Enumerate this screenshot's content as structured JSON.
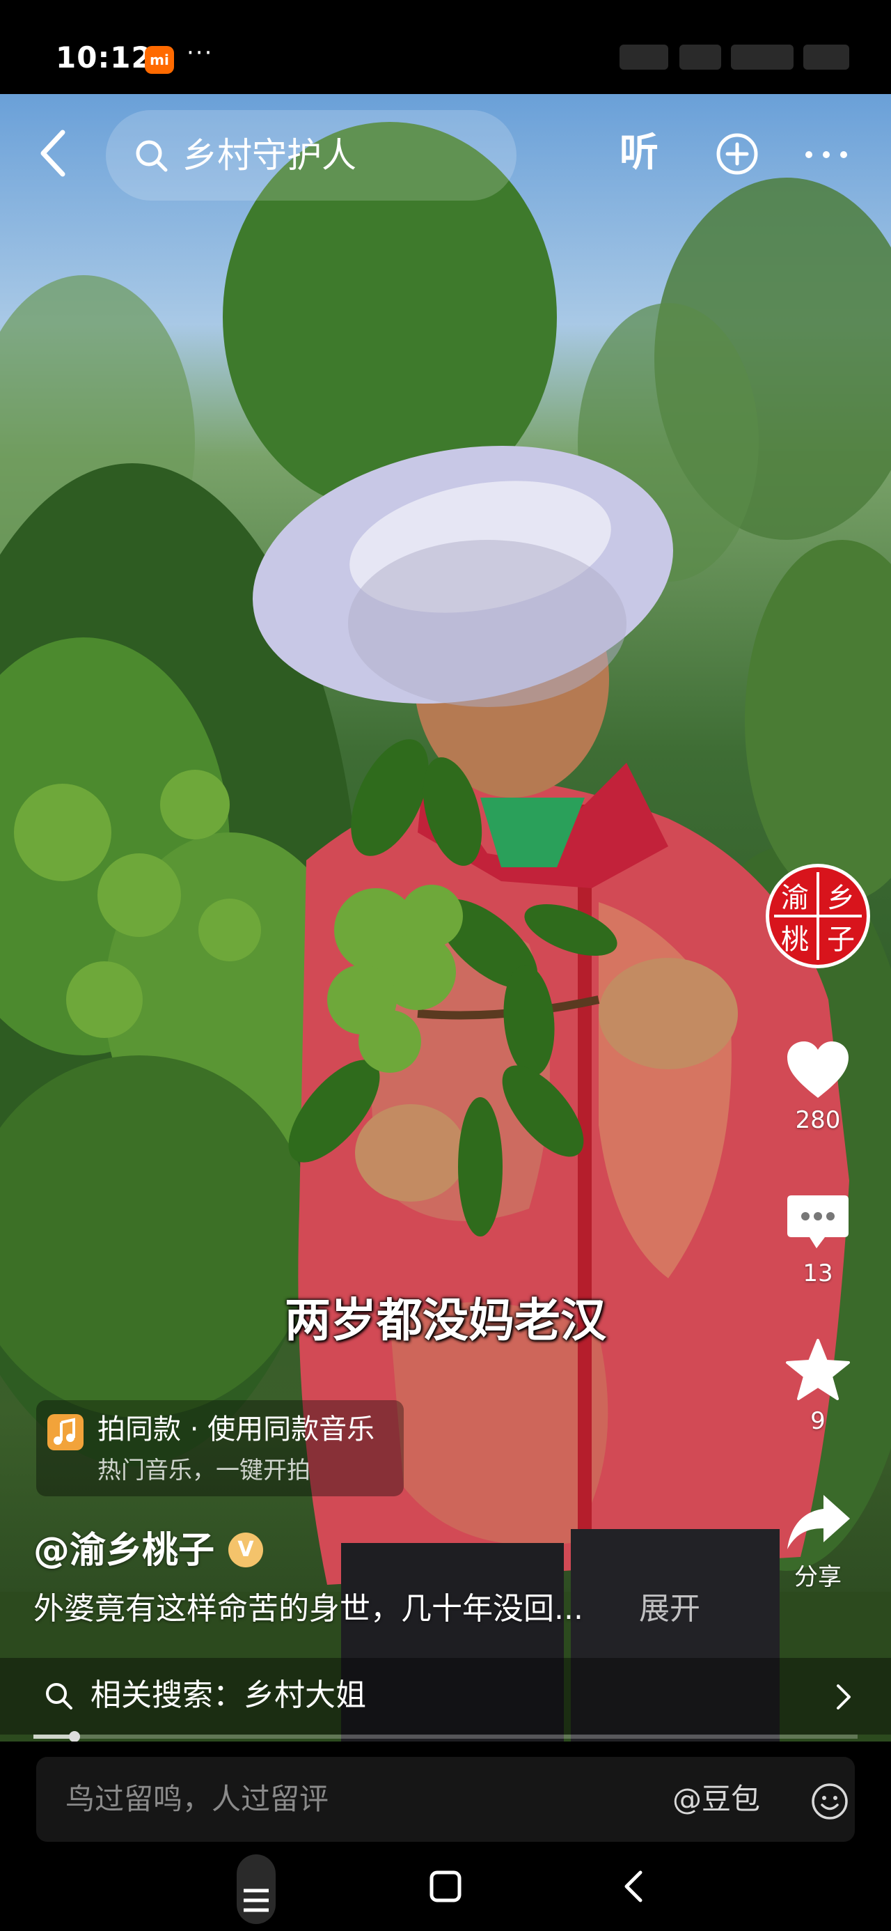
{
  "status_bar": {
    "time": "10:12",
    "app_badge": "mi",
    "more": "···"
  },
  "top_bar": {
    "search_query": "乡村守护人",
    "listen_label": "听"
  },
  "actions": {
    "avatar_text": [
      "渝",
      "乡",
      "桃",
      "子"
    ],
    "likes": "280",
    "comments": "13",
    "favorites": "9",
    "share_label": "分享"
  },
  "subtitle": "两岁都没妈老汉",
  "music": {
    "title": "拍同款 · 使用同款音乐",
    "subtitle": "热门音乐，一键开拍"
  },
  "author": {
    "name": "@渝乡桃子",
    "verified": "V"
  },
  "description": {
    "text": "外婆竟有这样命苦的身世，几十年没回...",
    "expand_label": "展开"
  },
  "related_search": {
    "label": "相关搜索：乡村大姐"
  },
  "playback": {
    "progress_percent": 5
  },
  "comment_bar": {
    "placeholder": "鸟过留鸣，人过留评",
    "mention": "@豆包"
  },
  "colors": {
    "like": "#ffffff",
    "music_icon": "#f2a33a",
    "avatar_red": "#d8141c",
    "badge": "#f4c36b"
  }
}
